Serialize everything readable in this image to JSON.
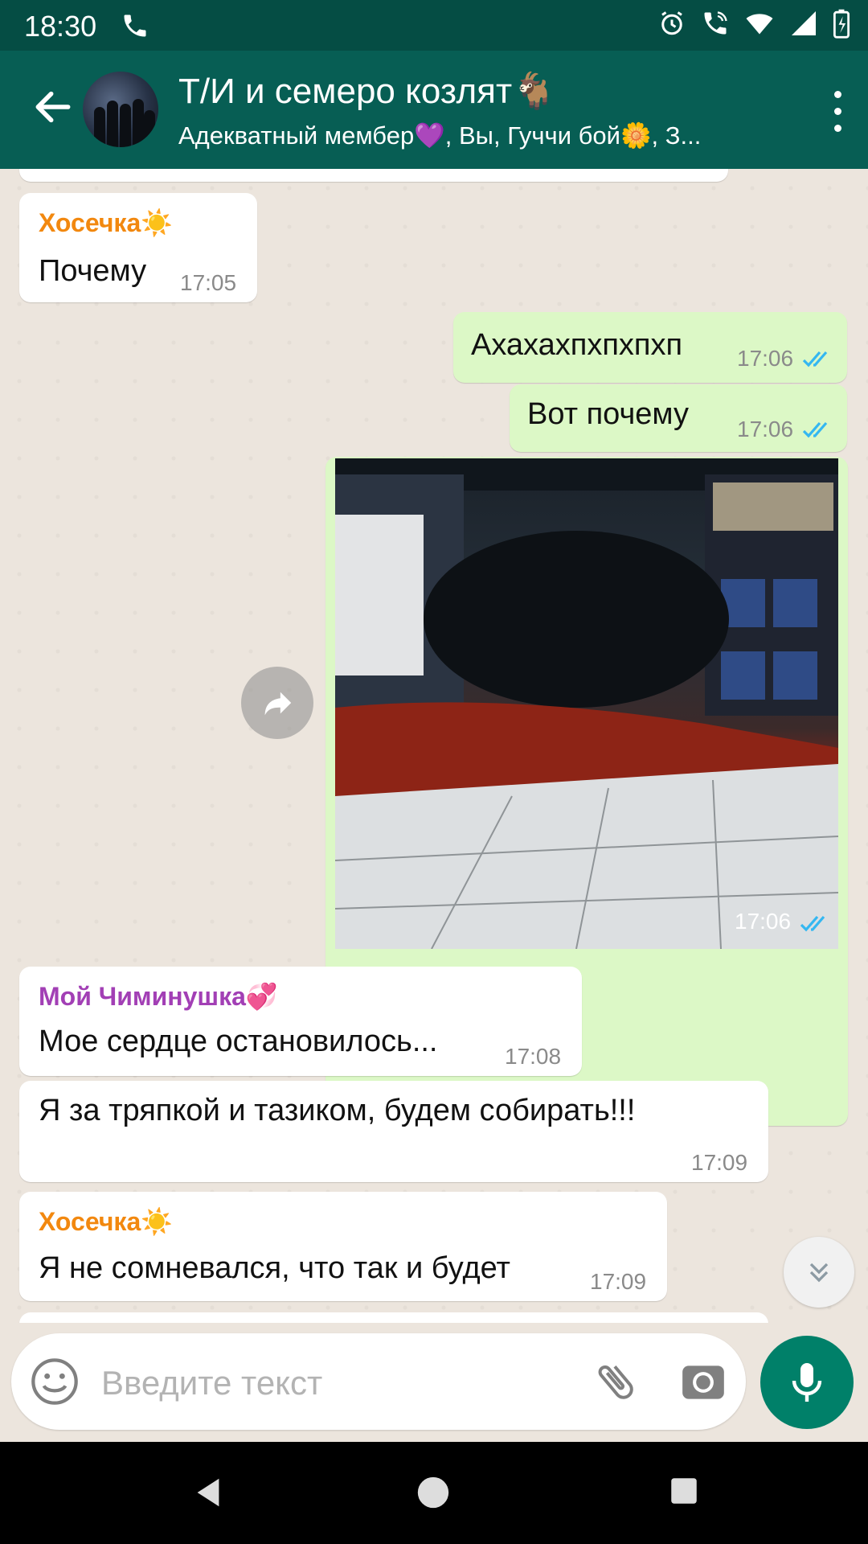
{
  "status_bar": {
    "time": "18:30"
  },
  "header": {
    "title": "Т/И и семеро козлят🐐",
    "subtitle": "Адекватный мембер💜, Вы, Гуччи бой🌼, З..."
  },
  "messages": [
    {
      "sender": "Хосечка☀️",
      "text": "Почему",
      "time": "17:05",
      "direction": "in"
    },
    {
      "text": "Ахахахпхпхпхп",
      "time": "17:06",
      "direction": "out",
      "status": "read"
    },
    {
      "text": "Вот почему",
      "time": "17:06",
      "direction": "out",
      "status": "read"
    },
    {
      "type": "image",
      "time": "17:06",
      "direction": "out",
      "status": "read"
    },
    {
      "sender": "Мой Чиминушка💞",
      "text": "Мое сердце остановилось...",
      "time": "17:08",
      "direction": "in"
    },
    {
      "text": "Я за тряпкой и тазиком, будем собирать!!!",
      "time": "17:09",
      "direction": "in"
    },
    {
      "sender": "Хосечка☀️",
      "text": "Я не сомневался, что так и будет",
      "time": "17:09",
      "direction": "in"
    }
  ],
  "composer": {
    "placeholder": "Введите текст"
  },
  "colors": {
    "header": "#075e54",
    "status_bar": "#054d44",
    "outgoing_bubble": "#dcf8c6",
    "incoming_bubble": "#ffffff",
    "sender_orange": "#f2880f",
    "sender_purple": "#a23fb5",
    "read_ticks": "#34b7f1",
    "mic_button": "#008069"
  },
  "icons": [
    "phone-icon",
    "alarm-icon",
    "wifi-call-icon",
    "wifi-icon",
    "signal-icon",
    "battery-icon",
    "back-arrow-icon",
    "more-vert-icon",
    "forward-icon",
    "scroll-down-icon",
    "emoji-icon",
    "attach-icon",
    "camera-icon",
    "mic-icon",
    "nav-back-icon",
    "nav-home-icon",
    "nav-recents-icon"
  ]
}
